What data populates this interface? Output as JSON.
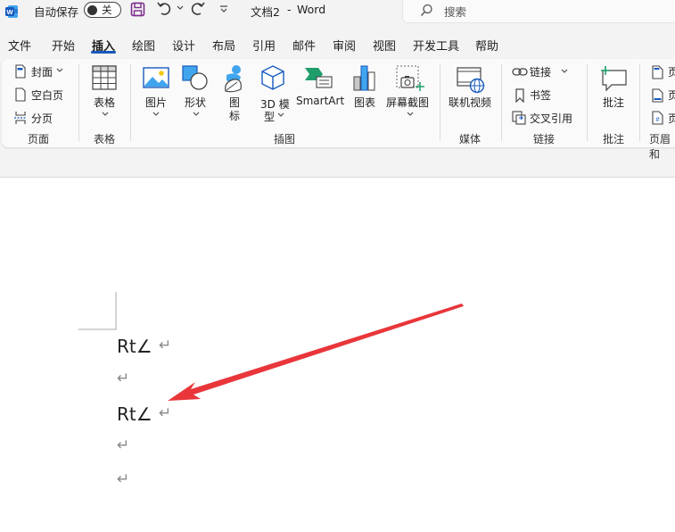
{
  "titlebar": {
    "autosave_label": "自动保存",
    "autosave_state": "关",
    "doc_title": "文档2",
    "separator": "-",
    "app_name": "Word",
    "search_placeholder": "搜索"
  },
  "tabs": [
    "文件",
    "开始",
    "插入",
    "绘图",
    "设计",
    "布局",
    "引用",
    "邮件",
    "审阅",
    "视图",
    "开发工具",
    "帮助"
  ],
  "active_tab": "插入",
  "ribbon": {
    "pages": {
      "cover": "封面",
      "blank": "空白页",
      "break": "分页",
      "group": "页面"
    },
    "tables": {
      "table": "表格",
      "group": "表格"
    },
    "illustrations": {
      "picture": "图片",
      "shapes": "形状",
      "icons_line1": "图",
      "icons_line2": "标",
      "model_line1": "3D 模",
      "model_line2": "型",
      "smartart": "SmartArt",
      "chart": "图表",
      "screenshot": "屏幕截图",
      "group": "插图"
    },
    "media": {
      "online_video": "联机视频",
      "group": "媒体"
    },
    "links": {
      "link": "链接",
      "bookmark": "书签",
      "cross_ref": "交叉引用",
      "group": "链接"
    },
    "comments": {
      "comment": "批注",
      "group": "批注"
    },
    "header_footer": {
      "item1": "页",
      "item2": "页",
      "item3": "页",
      "group": "页眉和"
    }
  },
  "document": {
    "line1": "Rt∠",
    "line3": "Rt∠",
    "paragraph_mark": "↵"
  },
  "colors": {
    "accent": "#185abd",
    "arrow": "#e8363b",
    "word_icon": "#185abd"
  }
}
